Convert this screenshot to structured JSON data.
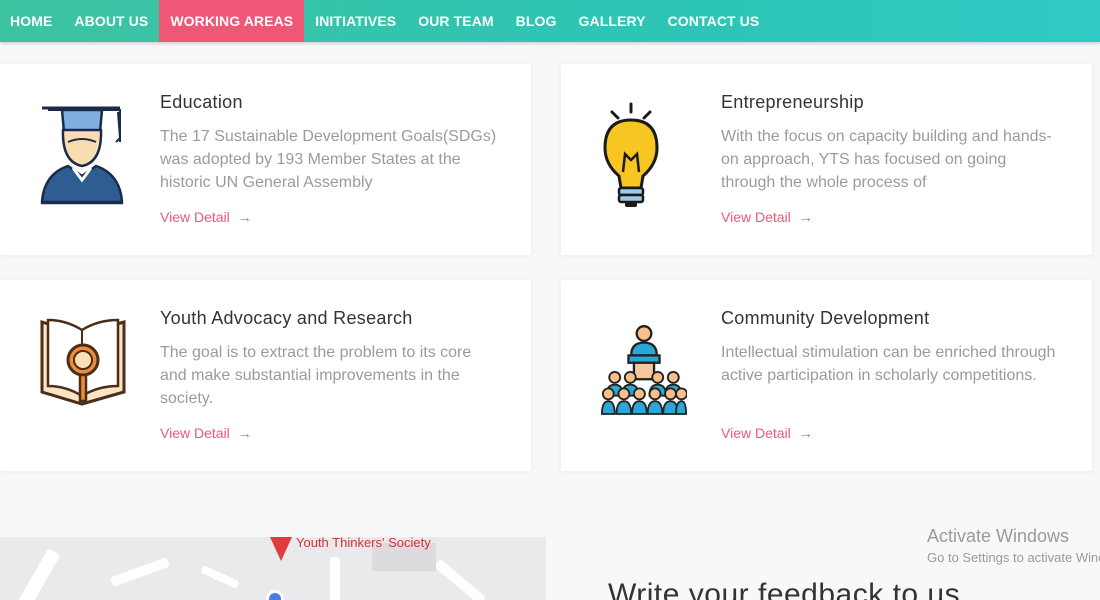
{
  "nav": {
    "items": [
      "HOME",
      "ABOUT US",
      "WORKING AREAS",
      "INITIATIVES",
      "OUR TEAM",
      "BLOG",
      "GALLERY",
      "CONTACT US"
    ],
    "active_index": 2,
    "active_color": "#ef5777"
  },
  "cards": [
    {
      "icon": "graduate-icon",
      "title": "Education",
      "description": "The 17 Sustainable Development Goals(SDGs) was adopted by 193 Member States at the historic UN General Assembly",
      "link": "View Detail"
    },
    {
      "icon": "lightbulb-icon",
      "title": "Entrepreneurship",
      "description": "With the focus on capacity building and hands-on approach, YTS has focused on going through the whole process of",
      "link": "View Detail"
    },
    {
      "icon": "book-magnifier-icon",
      "title": "Youth Advocacy and Research",
      "description": "The goal is to extract the problem to its core and make substantial improvements in the society.",
      "link": "View Detail"
    },
    {
      "icon": "audience-speaker-icon",
      "title": "Community Development",
      "description": "Intellectual stimulation can be enriched through active participation in scholarly competitions.",
      "link": "View Detail"
    }
  ],
  "map": {
    "place_label": "Youth Thinkers' Society"
  },
  "feedback": {
    "title": "Write your feedback to us"
  },
  "watermark": {
    "heading": "Activate Windows",
    "sub": "Go to Settings to activate Windows."
  },
  "colors": {
    "accent": "#ef5777",
    "nav_teal": "#2cc5b6"
  }
}
